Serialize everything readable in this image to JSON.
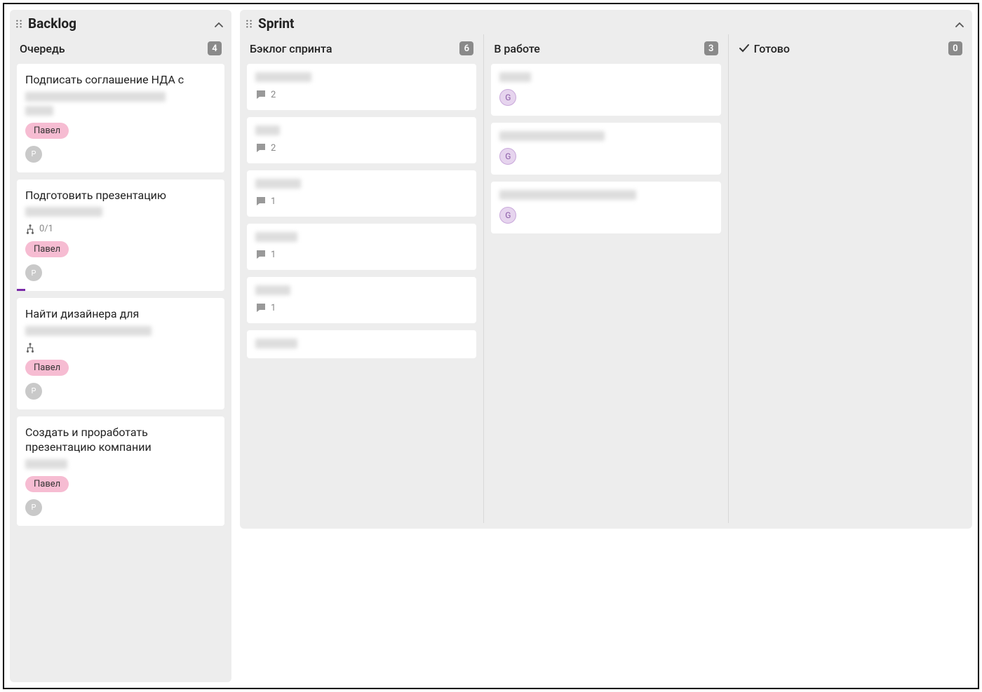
{
  "backlog": {
    "title": "Backlog",
    "column": {
      "title": "Очередь",
      "count": "4",
      "cards": [
        {
          "title": "Подписать соглашение НДА с",
          "tag": "Павел",
          "avatar": "P"
        },
        {
          "title": "Подготовить презентацию",
          "tag": "Павел",
          "avatar": "P",
          "subtask": "0/1"
        },
        {
          "title": "Найти дизайнера для",
          "tag": "Павел",
          "avatar": "P",
          "subtask_icon_only": true
        },
        {
          "title": "Создать и проработать презентацию компании",
          "tag": "Павел",
          "avatar": "P"
        }
      ]
    }
  },
  "sprint": {
    "title": "Sprint",
    "columns": [
      {
        "title": "Бэклог спринта",
        "count": "6",
        "cards": [
          {
            "comments": "2"
          },
          {
            "comments": "2"
          },
          {
            "comments": "1"
          },
          {
            "comments": "1"
          },
          {
            "comments": "1"
          },
          {}
        ]
      },
      {
        "title": "В работе",
        "count": "3",
        "cards": [
          {
            "avatar_g": "G"
          },
          {
            "avatar_g": "G"
          },
          {
            "avatar_g": "G"
          }
        ]
      },
      {
        "title": "Готово",
        "count": "0",
        "check": true,
        "cards": []
      }
    ]
  }
}
